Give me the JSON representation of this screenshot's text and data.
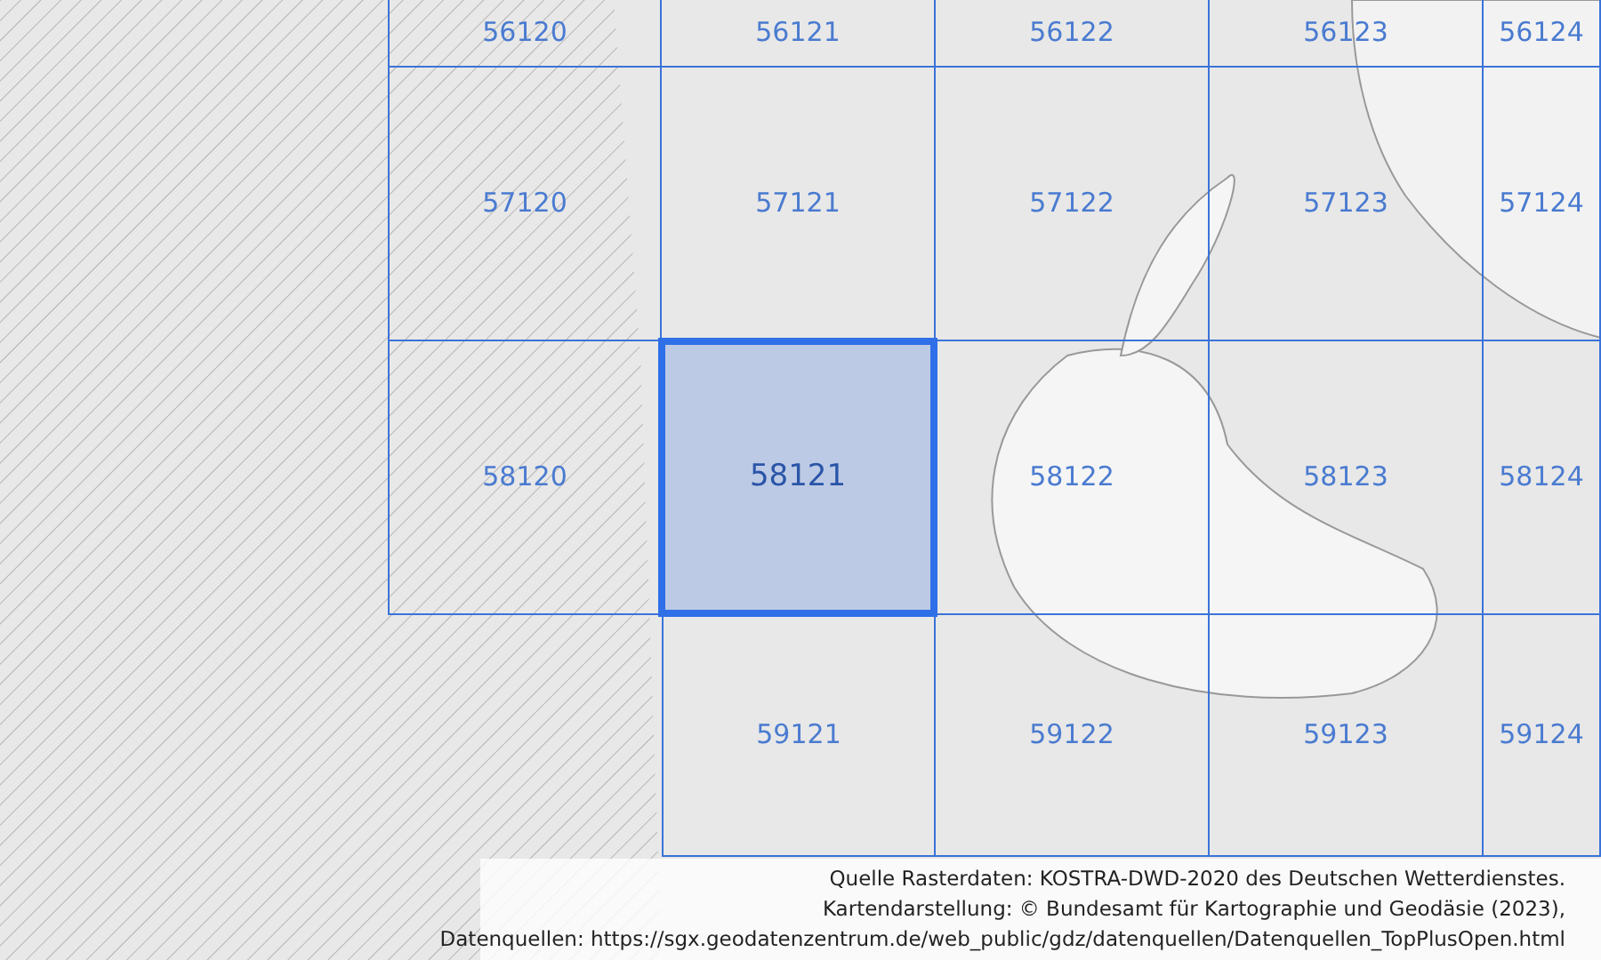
{
  "grid": {
    "rows": [
      {
        "cells": [
          {
            "kind": "tile",
            "label": "56120",
            "selected": false
          },
          {
            "kind": "tile",
            "label": "56121",
            "selected": false
          },
          {
            "kind": "tile",
            "label": "56122",
            "selected": false
          },
          {
            "kind": "tile",
            "label": "56123",
            "selected": false
          },
          {
            "kind": "tile",
            "label": "56124",
            "selected": false
          }
        ]
      },
      {
        "cells": [
          {
            "kind": "tile",
            "label": "57120",
            "selected": false
          },
          {
            "kind": "tile",
            "label": "57121",
            "selected": false
          },
          {
            "kind": "tile",
            "label": "57122",
            "selected": false
          },
          {
            "kind": "tile",
            "label": "57123",
            "selected": false
          },
          {
            "kind": "tile",
            "label": "57124",
            "selected": false
          }
        ]
      },
      {
        "cells": [
          {
            "kind": "tile",
            "label": "58120",
            "selected": false
          },
          {
            "kind": "tile",
            "label": "58121",
            "selected": true
          },
          {
            "kind": "tile",
            "label": "58122",
            "selected": false
          },
          {
            "kind": "tile",
            "label": "58123",
            "selected": false
          },
          {
            "kind": "tile",
            "label": "58124",
            "selected": false
          }
        ]
      },
      {
        "cells": [
          {
            "kind": "empty"
          },
          {
            "kind": "tile",
            "label": "59121",
            "selected": false
          },
          {
            "kind": "tile",
            "label": "59122",
            "selected": false
          },
          {
            "kind": "tile",
            "label": "59123",
            "selected": false
          },
          {
            "kind": "tile",
            "label": "59124",
            "selected": false
          }
        ]
      }
    ]
  },
  "attribution": [
    "Quelle Rasterdaten: KOSTRA-DWD-2020 des Deutschen Wetterdienstes.",
    "Kartendarstellung: © Bundesamt für Kartographie und Geodäsie (2023),",
    "Datenquellen: https://sgx.geodatenzentrum.de/web_public/gdz/datenquellen/Datenquellen_TopPlusOpen.html"
  ]
}
